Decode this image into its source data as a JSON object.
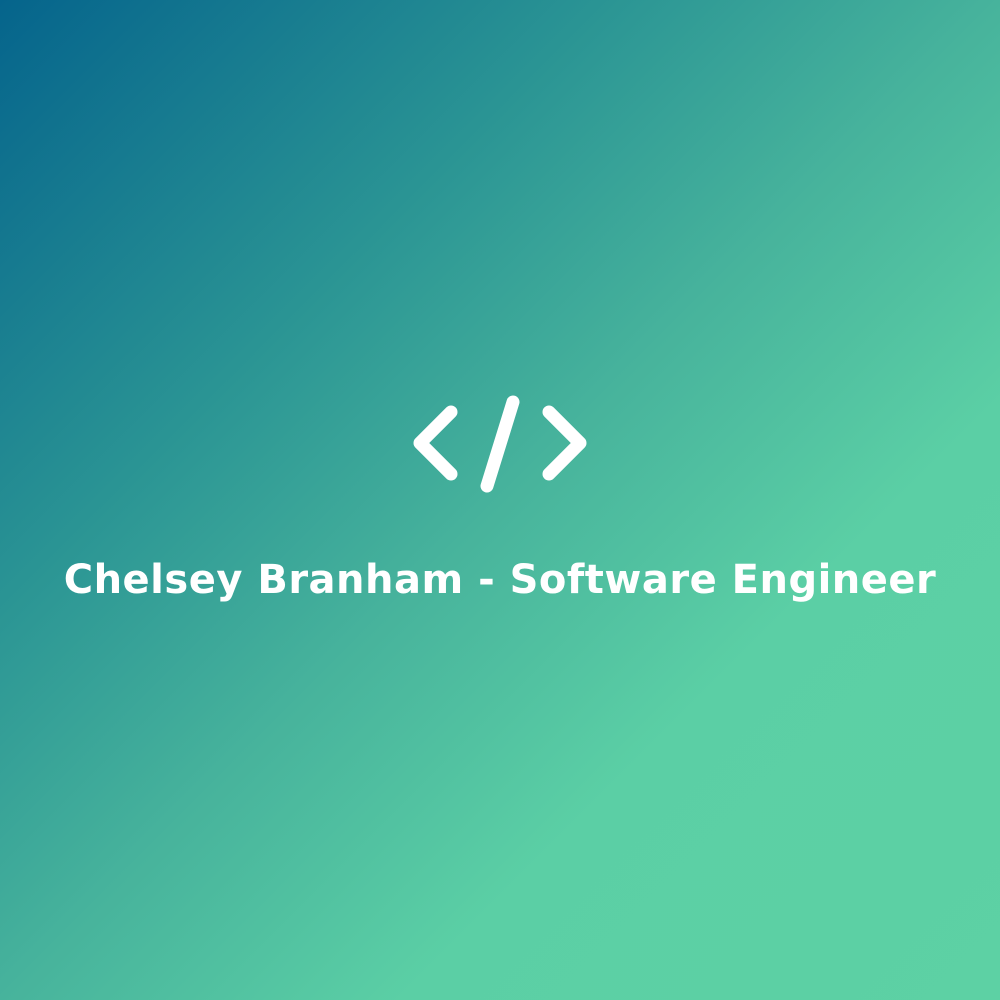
{
  "logo": {
    "icon": "code-brackets-icon",
    "title": "Chelsey Branham - Software Engineer"
  },
  "colors": {
    "gradient_start": "#05648c",
    "gradient_end": "#5dd1a4",
    "foreground": "#ffffff"
  }
}
